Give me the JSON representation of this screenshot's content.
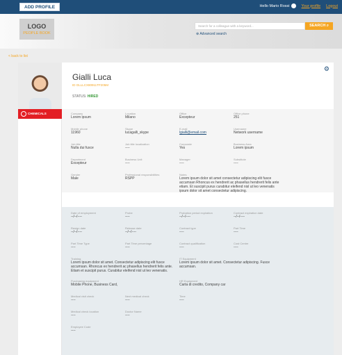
{
  "topbar": {
    "add_profile": "ADD PROFILE",
    "hello": "Hello Mario Rossi",
    "your_profile": "Your profile",
    "logout": "Logout"
  },
  "header": {
    "logo": "LOGO",
    "logo_sub": "PEOPLE BOOK",
    "search_placeholder": "Search for a colleague with a keyword...",
    "search_btn": "SEARCH",
    "advanced": "Advanced search"
  },
  "back": "< back to list",
  "profile": {
    "name": "Gialli Luca",
    "id": "ID GLLLCX80911TF205M",
    "status_label": "STATUS:",
    "status_value": "HIRED",
    "department_tag": "CHEMICALS"
  },
  "section1": [
    [
      {
        "l": "Company",
        "v": "Lorem ipsum"
      },
      {
        "l": "Location",
        "v": "Milano"
      },
      {
        "l": "Office",
        "v": "Excepteur"
      },
      {
        "l": "Office phone",
        "v": "251"
      }
    ],
    [
      {
        "l": "Mobile phone",
        "v": "11960"
      },
      {
        "l": "Skype",
        "v": "lucagalli_skype"
      },
      {
        "l": "E-mail",
        "v": "lgialli@email.com"
      },
      {
        "l": "Username",
        "v": "Network username"
      }
    ],
    [
      {
        "l": "Job title",
        "v": "Nulla dui fusce"
      },
      {
        "l": "Job title localization",
        "v": "----"
      },
      {
        "l": "Corporate",
        "v": "Yes"
      },
      {
        "l": "Business Area",
        "v": "Lorem ipsum"
      }
    ],
    [
      {
        "l": "Department",
        "v": "Excepteur"
      },
      {
        "l": "Business Unit",
        "v": "----"
      },
      {
        "l": "Manager",
        "v": "----"
      },
      {
        "l": "Substitute",
        "v": "----"
      }
    ],
    [
      {
        "l": "Gender",
        "v": "Male"
      },
      {
        "l": "Professional responsibilities",
        "v": "RSPP"
      },
      {
        "l": "Notes",
        "v": "Lorem ipsum dolor sit amet consectetur adipiscing elit fusce accumsan Rhoncus ex hendrerit ac phasellus hendrerit felis ante etiam. Et suscipit purus curabitur eleifend nisl ut leo venenatis ipsum dolor sit amet consectetur adipiscing."
      }
    ]
  ],
  "section2": [
    [
      {
        "l": "Date of employment",
        "v": "--/--/----"
      },
      {
        "l": "Probe",
        "v": "----"
      },
      {
        "l": "Probation period expiration",
        "v": "--/--/----"
      },
      {
        "l": "Contract expiration date",
        "v": "--/--/----"
      }
    ],
    [
      {
        "l": "Resign date",
        "v": "--/--/----"
      },
      {
        "l": "Release date",
        "v": "--/--/----"
      },
      {
        "l": "Contract type",
        "v": "----"
      },
      {
        "l": "Part Time",
        "v": "----"
      }
    ],
    [
      {
        "l": "Part Time Type",
        "v": "----"
      },
      {
        "l": "Part Time percentage",
        "v": "----"
      },
      {
        "l": "Contract qualification",
        "v": "----"
      },
      {
        "l": "Cost Centre",
        "v": "----"
      }
    ],
    [
      {
        "l": "Training",
        "v": "Lorem ipsum dolor sit amet. Consectetur adipiscing elit fusce accumsan. Rhoncus ex hendrerit ac phasellus hendrerit felis ante. Etiam et suscipit purus. Curabitur eleifend nisl ut leo venenatis."
      },
      {
        "l": "IT Equipment",
        "v": "Lorem ipsum dolor sit amet. Consectetur adipiscing. Fusce accumsan."
      }
    ],
    [
      {
        "l": "Purchasing equipment",
        "v": "Mobile Phone, Business Card,"
      },
      {
        "l": "HR Equipment",
        "v": "Carta di credito, Company car"
      }
    ],
    [
      {
        "l": "Medical visit check",
        "v": "----"
      },
      {
        "l": "Next medical check",
        "v": "----"
      },
      {
        "l": "Time",
        "v": "----"
      }
    ],
    [
      {
        "l": "Medical check location",
        "v": "----"
      },
      {
        "l": "Doctor Name",
        "v": "----"
      }
    ],
    [
      {
        "l": "Employee Code",
        "v": "----"
      }
    ]
  ]
}
